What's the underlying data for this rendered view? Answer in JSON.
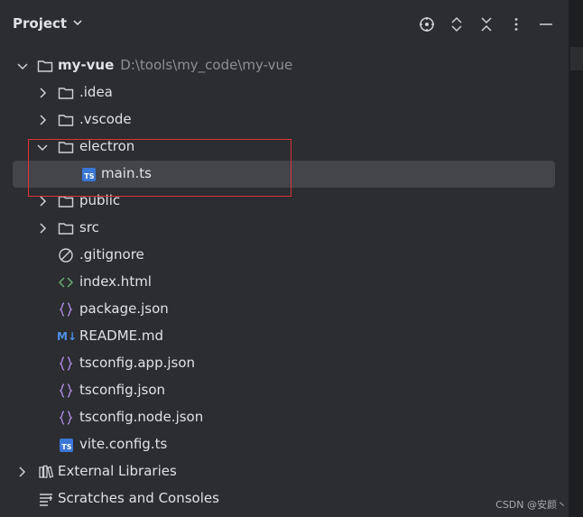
{
  "header": {
    "title": "Project",
    "icons": [
      "chevron-down-icon",
      "locate-icon",
      "expand-icon",
      "collapse-icon",
      "more-icon",
      "minimize-icon"
    ]
  },
  "tree": {
    "root": {
      "label": "my-vue",
      "path": "D:\\tools\\my_code\\my-vue"
    },
    "items": [
      {
        "label": ".idea",
        "kind": "folder"
      },
      {
        "label": ".vscode",
        "kind": "folder"
      },
      {
        "label": "electron",
        "kind": "folder"
      },
      {
        "label": "main.ts",
        "kind": "ts"
      },
      {
        "label": "public",
        "kind": "folder"
      },
      {
        "label": "src",
        "kind": "folder"
      },
      {
        "label": ".gitignore",
        "kind": "ignore"
      },
      {
        "label": "index.html",
        "kind": "html"
      },
      {
        "label": "package.json",
        "kind": "json"
      },
      {
        "label": "README.md",
        "kind": "md"
      },
      {
        "label": "tsconfig.app.json",
        "kind": "json"
      },
      {
        "label": "tsconfig.json",
        "kind": "json"
      },
      {
        "label": "tsconfig.node.json",
        "kind": "json"
      },
      {
        "label": "vite.config.ts",
        "kind": "ts"
      }
    ],
    "external": "External Libraries",
    "scratches": "Scratches and Consoles"
  },
  "badges": {
    "ts": "TS",
    "md": "M↓"
  },
  "colors": {
    "background": "#2b2d30",
    "selection": "#43454a",
    "ts": "#3b77d6",
    "json": "#b18ae8",
    "html": "#6aab73",
    "highlight": "#e0313a"
  },
  "watermark": "CSDN @安颜丶"
}
